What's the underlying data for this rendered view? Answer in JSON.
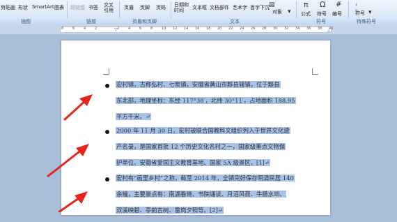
{
  "ribbon": {
    "buttons": [
      {
        "label": "剪贴画",
        "dim": false
      },
      {
        "label": "形状",
        "dim": false
      },
      {
        "label": "SmartArt",
        "dim": false
      },
      {
        "label": "图表",
        "dim": false
      },
      {
        "label": "超链接",
        "dim": true
      },
      {
        "label": "书签",
        "dim": false
      },
      {
        "label": "交叉引用",
        "dim": false
      },
      {
        "label": "页眉",
        "dim": false
      },
      {
        "label": "页脚",
        "dim": false
      },
      {
        "label": "页码",
        "dim": false
      },
      {
        "label": "日期和时间",
        "dim": false
      },
      {
        "label": "文本框",
        "dim": false
      },
      {
        "label": "文档部件",
        "dim": false
      },
      {
        "label": "艺术字",
        "dim": false
      },
      {
        "label": "首字下沉",
        "dim": false
      },
      {
        "label": "对象",
        "dim": false
      },
      {
        "label": "公式",
        "dim": false
      },
      {
        "label": "符号",
        "dim": false
      },
      {
        "label": "编号",
        "dim": false
      },
      {
        "label": "符号",
        "dim": false
      }
    ],
    "groups": [
      "插图",
      "链接",
      "页眉和页脚",
      "文本",
      "符号",
      "特殊符号"
    ]
  },
  "ruler": {
    "numbers": [
      "8",
      "6",
      "4",
      "2",
      "",
      "2",
      "4",
      "6",
      "8",
      "10",
      "12",
      "14",
      "16",
      "18",
      "20",
      "22",
      "24",
      "26",
      "28",
      "30",
      "32",
      "34",
      "36",
      "38",
      "40"
    ]
  },
  "document": {
    "paragraphs": [
      {
        "lines": [
          "宏村镇，古称弘村、七炭镇，安徽省黄山市黟县辖镇，位于黟县",
          "东北部，地理坐标：东经 117°38′，北纬 30°11′，占地面积 188.95",
          "平方千米。↵"
        ]
      },
      {
        "lines": [
          "2000 年 11 月 30 日，宏村被联合国教科文组织列入于世界文化遗",
          "产名录，是国家首批 12 个历史文化名村之一，国家级重点文物保",
          "护单位、安徽省爱国主义教育基地、国家 5A 级景区。[1]↵"
        ]
      },
      {
        "lines": [
          "宏村有“画里乡村”之称，截至 2014 年，全镇完好保存明清民居 140",
          "余幢，主要景点有：南湖春晓、书院诵读、月沼风荷、牛肠水圳、",
          "双溪映碧、亭前古树、雷岗夕照等。[2]↵"
        ]
      }
    ]
  },
  "colors": {
    "selection": "#a7c4e8",
    "arrow": "#e5251c",
    "ribbon": "#dce8f7"
  }
}
